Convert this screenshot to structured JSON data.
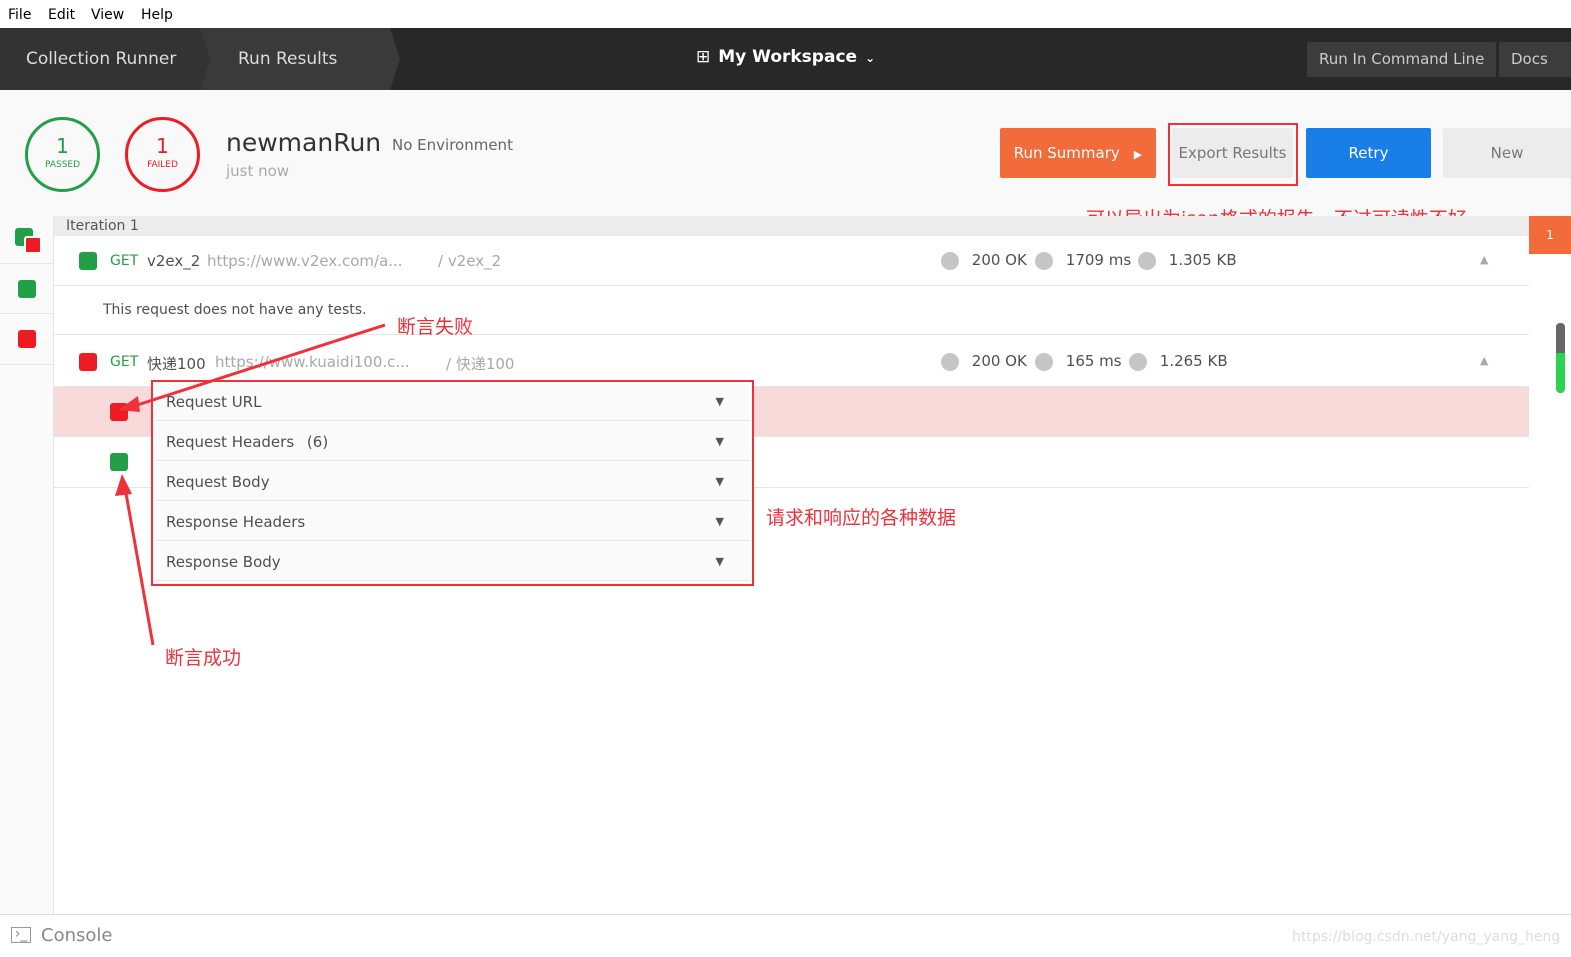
{
  "menu": [
    "File",
    "Edit",
    "View",
    "Help"
  ],
  "header": {
    "breadcrumbs": [
      "Collection Runner",
      "Run Results"
    ],
    "workspace": "My Workspace",
    "run_cli": "Run In Command Line",
    "docs": "Docs"
  },
  "summary": {
    "passed_count": "1",
    "passed_label": "PASSED",
    "failed_count": "1",
    "failed_label": "FAILED",
    "name": "newmanRun",
    "environment": "No Environment",
    "time": "just now"
  },
  "actions": {
    "run_summary": "Run Summary",
    "export": "Export Results",
    "retry": "Retry",
    "new": "New"
  },
  "iteration": "Iteration 1",
  "badge": "1",
  "requests": [
    {
      "method": "GET",
      "name": "v2ex_2",
      "url": "https://www.v2ex.com/a...",
      "path": "/ v2ex_2",
      "status": "200 OK",
      "time": "1709 ms",
      "size": "1.305 KB",
      "note": "This request does not have any tests."
    },
    {
      "method": "GET",
      "name": "快递100",
      "url": "https://www.kuaidi100.c...",
      "path": "/ 快递100",
      "status": "200 OK",
      "time": "165 ms",
      "size": "1.265 KB"
    }
  ],
  "dropdown": [
    {
      "label": "Request URL"
    },
    {
      "label": "Request Headers",
      "count": "(6)"
    },
    {
      "label": "Request Body"
    },
    {
      "label": "Response Headers"
    },
    {
      "label": "Response Body"
    }
  ],
  "annotations": {
    "export": "可以导出为json格式的报告，不过可读性不好",
    "fail": "断言失败",
    "data": "请求和响应的各种数据",
    "success": "断言成功"
  },
  "console": "Console",
  "watermark": "https://blog.csdn.net/yang_yang_heng",
  "colors": {
    "pass": "#23a047",
    "fail": "#ed1c24",
    "accent": "#f26b3a",
    "retry": "#1a7ee8"
  }
}
